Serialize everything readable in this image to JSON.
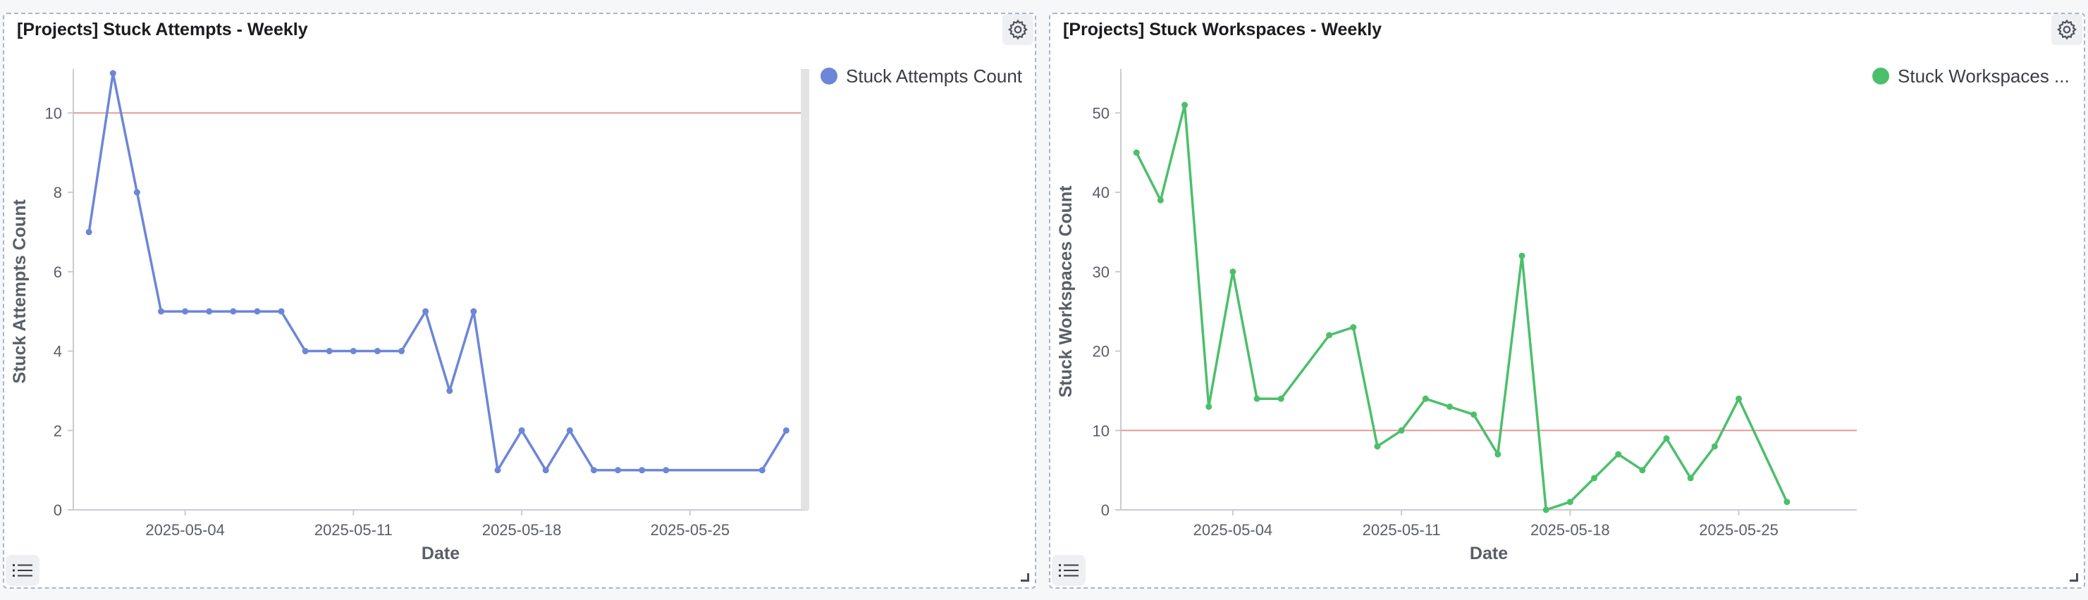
{
  "panels": [
    {
      "title": "[Projects] Stuck Attempts - Weekly",
      "settings_icon": "gear-icon",
      "list_icon": "list-icon"
    },
    {
      "title": "[Projects] Stuck Workspaces - Weekly",
      "settings_icon": "gear-icon",
      "list_icon": "list-icon"
    }
  ],
  "colors": {
    "series1": "#6d86d8",
    "series2": "#4cbf6b",
    "goal_line": "#e59a9a",
    "axis": "#c9ccd1",
    "scrollbar": "#e3e3e3"
  },
  "chart_data": [
    {
      "type": "line",
      "title": "[Projects] Stuck Attempts - Weekly",
      "xlabel": "Date",
      "ylabel": "Stuck Attempts Count",
      "x_ticks": [
        "2025-05-04",
        "2025-05-11",
        "2025-05-18",
        "2025-05-25"
      ],
      "y_ticks": [
        "0",
        "2",
        "4",
        "6",
        "8",
        "10"
      ],
      "ylim": [
        0,
        11
      ],
      "goal_line": 10,
      "legend_position": "top-right",
      "series": [
        {
          "name": "Stuck Attempts Count",
          "x": [
            "2025-04-30",
            "2025-05-01",
            "2025-05-02",
            "2025-05-03",
            "2025-05-04",
            "2025-05-05",
            "2025-05-06",
            "2025-05-07",
            "2025-05-08",
            "2025-05-09",
            "2025-05-10",
            "2025-05-11",
            "2025-05-12",
            "2025-05-13",
            "2025-05-14",
            "2025-05-15",
            "2025-05-16",
            "2025-05-17",
            "2025-05-18",
            "2025-05-19",
            "2025-05-20",
            "2025-05-21",
            "2025-05-22",
            "2025-05-23",
            "2025-05-24",
            "2025-05-28",
            "2025-05-29"
          ],
          "values": [
            7,
            11,
            8,
            5,
            5,
            5,
            5,
            5,
            5,
            4,
            4,
            4,
            4,
            4,
            5,
            3,
            5,
            1,
            2,
            1,
            2,
            1,
            1,
            1,
            1,
            1,
            2
          ]
        }
      ]
    },
    {
      "type": "line",
      "title": "[Projects] Stuck Workspaces - Weekly",
      "xlabel": "Date",
      "ylabel": "Stuck Workspaces Count",
      "x_ticks": [
        "2025-05-04",
        "2025-05-11",
        "2025-05-18",
        "2025-05-25"
      ],
      "y_ticks": [
        "0",
        "10",
        "20",
        "30",
        "40",
        "50"
      ],
      "ylim": [
        0,
        55
      ],
      "goal_line": 10,
      "legend_position": "top-right",
      "series": [
        {
          "name": "Stuck Workspaces ...",
          "x": [
            "2025-04-30",
            "2025-05-01",
            "2025-05-02",
            "2025-05-03",
            "2025-05-04",
            "2025-05-05",
            "2025-05-06",
            "2025-05-08",
            "2025-05-09",
            "2025-05-10",
            "2025-05-11",
            "2025-05-12",
            "2025-05-13",
            "2025-05-14",
            "2025-05-15",
            "2025-05-16",
            "2025-05-17",
            "2025-05-18",
            "2025-05-19",
            "2025-05-20",
            "2025-05-21",
            "2025-05-22",
            "2025-05-23",
            "2025-05-24",
            "2025-05-25",
            "2025-05-27"
          ],
          "values": [
            45,
            39,
            51,
            13,
            30,
            14,
            14,
            22,
            23,
            8,
            10,
            14,
            13,
            12,
            7,
            32,
            0,
            1,
            4,
            7,
            5,
            9,
            4,
            8,
            14,
            1
          ]
        }
      ]
    }
  ]
}
